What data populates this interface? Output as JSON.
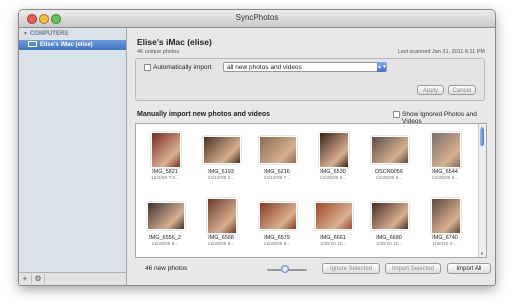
{
  "window": {
    "title": "SyncPhotos"
  },
  "sidebar": {
    "header": "COMPUTERS",
    "items": [
      {
        "label": "Elise's iMac (elise)"
      }
    ]
  },
  "device": {
    "title": "Elise's iMac (elise)",
    "subtitle": "46 unique photos",
    "last_scanned": "Last scanned Jan 31, 2011 6:11 PM"
  },
  "auto_import": {
    "label": "Automatically import",
    "checked": false,
    "selected_option": "all new photos and videos",
    "apply_label": "Apply",
    "cancel_label": "Cancel"
  },
  "manual": {
    "title": "Manually import new photos and videos",
    "show_ignored_label": "Show Ignored Photos and Videos",
    "show_ignored_checked": false
  },
  "photos": [
    {
      "name": "IMG_5821",
      "date": "12/4/09 7:0..."
    },
    {
      "name": "IMG_6193",
      "date": "12/18/09 3..."
    },
    {
      "name": "IMG_6216",
      "date": "12/18/09 7..."
    },
    {
      "name": "IMG_6530",
      "date": "12/25/09 8..."
    },
    {
      "name": "DSCN0056",
      "date": "12/25/09 8..."
    },
    {
      "name": "IMG_6544",
      "date": "12/25/09 8..."
    },
    {
      "name": "IMG_6556_2",
      "date": "12/25/09 9..."
    },
    {
      "name": "IMG_6568",
      "date": "12/25/09 9..."
    },
    {
      "name": "IMG_6579",
      "date": "12/25/09 9..."
    },
    {
      "name": "IMG_6661",
      "date": "1/30/10 11..."
    },
    {
      "name": "IMG_6680",
      "date": "1/30/10 11..."
    },
    {
      "name": "IMG_6740",
      "date": "1/30/10 4:..."
    }
  ],
  "thumb_colors": [
    "#7a2a22",
    "#4a3020",
    "#8a6a50",
    "#3a2418",
    "#5a4a44",
    "#7a6e68",
    "#3e3230",
    "#6a3a2a",
    "#8a3a20",
    "#a04a2a",
    "#4a2a24",
    "#5a4840"
  ],
  "footer": {
    "count_label": "46 new photos",
    "thumbnail_size_fraction": 0.45,
    "ignore_selected_label": "Ignore Selected",
    "import_selected_label": "Import Selected",
    "import_all_label": "Import All"
  }
}
